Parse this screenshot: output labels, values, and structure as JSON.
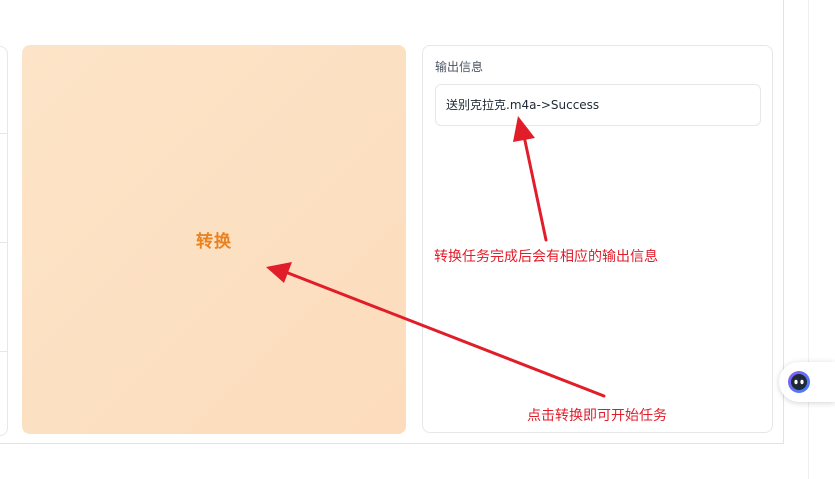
{
  "convert": {
    "label": "转换"
  },
  "output": {
    "title": "输出信息",
    "message": "送别克拉克.m4a->Success"
  },
  "annotations": {
    "output_hint": "转换任务完成后会有相应的输出信息",
    "convert_hint": "点击转换即可开始任务"
  },
  "colors": {
    "accent": "#e98322",
    "button_bg": "#fde4c8",
    "annotation": "#e11d2a"
  },
  "icons": {
    "assistant": "assistant-face-icon"
  }
}
